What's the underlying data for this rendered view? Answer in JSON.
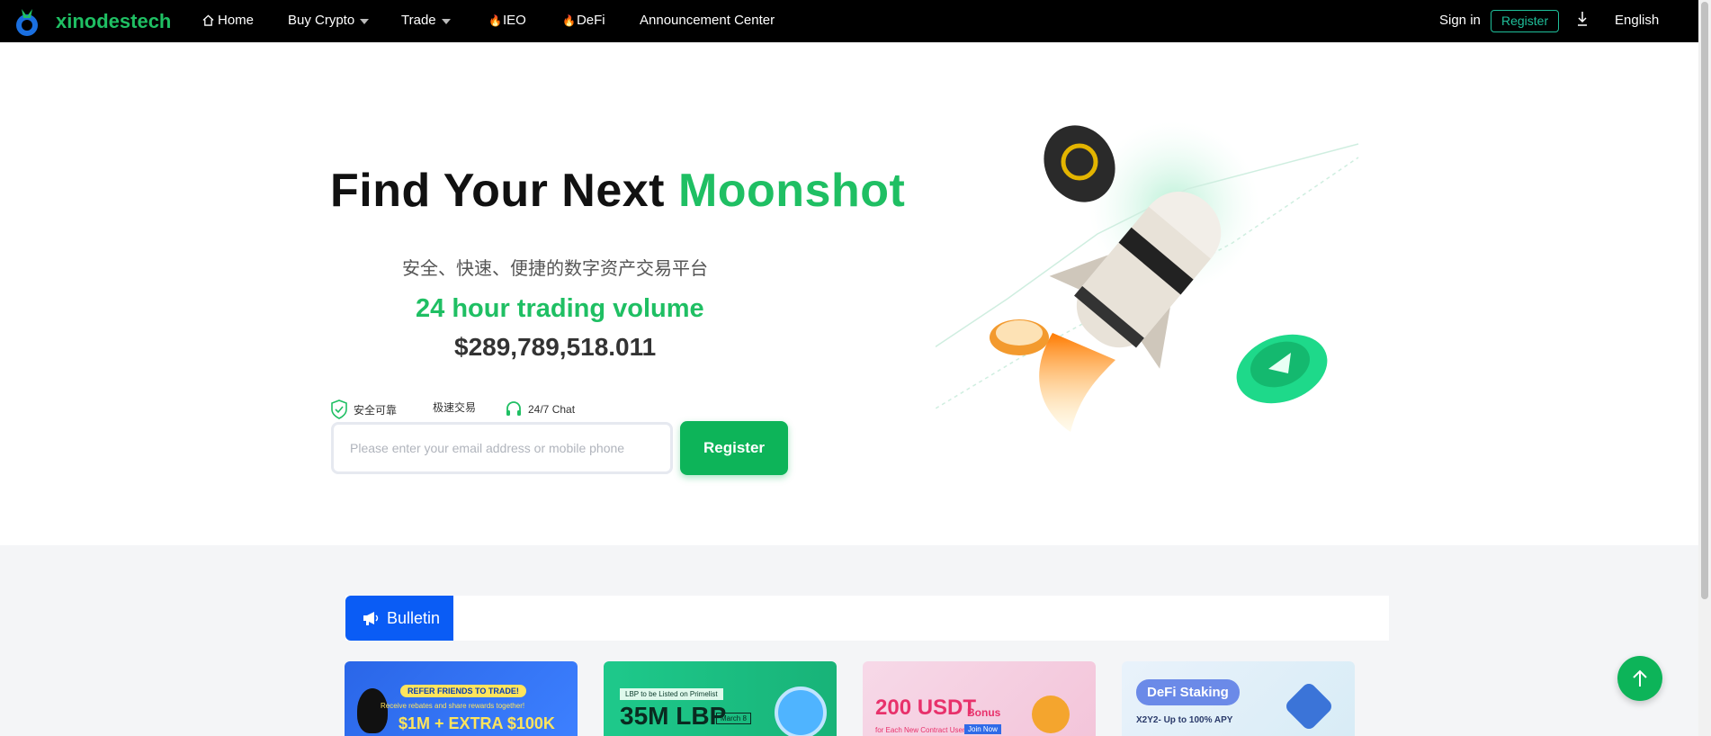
{
  "nav": {
    "brand": "xinodestech",
    "items": [
      {
        "label": "Home",
        "icon": "home-icon"
      },
      {
        "label": "Buy Crypto",
        "icon": "caret-down-icon"
      },
      {
        "label": "Trade",
        "icon": "caret-down-icon"
      },
      {
        "label": "IEO",
        "icon": "flame-icon"
      },
      {
        "label": "DeFi",
        "icon": "flame-icon"
      },
      {
        "label": "Announcement Center"
      }
    ],
    "sign_in": "Sign in",
    "register": "Register",
    "language": "English"
  },
  "hero": {
    "title_main": "Find Your Next ",
    "title_accent": "Moonshot",
    "subtitle": "安全、快速、便捷的数字资产交易平台",
    "volume_label": "24 hour trading volume",
    "volume_value": "$289,789,518.011",
    "features": [
      {
        "label": "安全可靠",
        "icon": "shield-check-icon"
      },
      {
        "label": "极速交易",
        "icon": "lightning-icon"
      },
      {
        "label": "24/7 Chat",
        "icon": "headset-icon"
      }
    ],
    "email_placeholder": "Please enter your email address or mobile phone",
    "register_button": "Register"
  },
  "bulletin": {
    "tab_label": "Bulletin",
    "cards": [
      {
        "line1": "REFER FRIENDS TO TRADE!",
        "line2": "Receive rebates and share rewards together!",
        "line3": "$1M + EXTRA $100K"
      },
      {
        "line1": "LBP to be Listed on Primelist",
        "line2": "35M LBP",
        "line3": "March 8"
      },
      {
        "line1": "200 USDT",
        "line2": "Bonus",
        "line3": "for Each New Contract User",
        "line4": "Join Now"
      },
      {
        "line1": "DeFi Staking",
        "line2": "X2Y2- Up to 100% APY"
      }
    ]
  },
  "colors": {
    "brand_green": "#1fbf63",
    "button_green": "#0db459",
    "bulletin_blue": "#0a5cf5",
    "nav_bg": "#000000"
  }
}
